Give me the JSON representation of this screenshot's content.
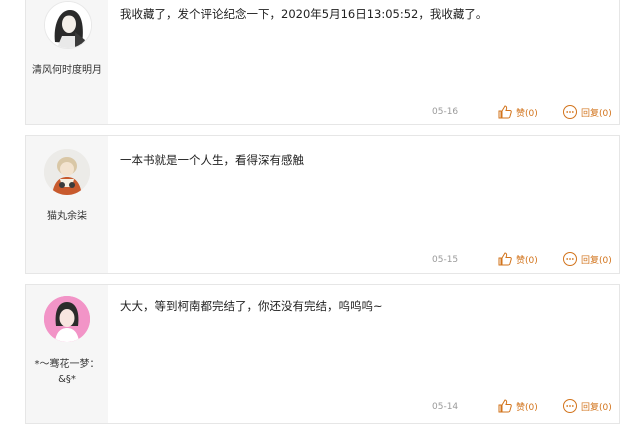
{
  "comments": [
    {
      "username": "清风何时度明月",
      "content": "我收藏了，发个评论纪念一下，2020年5月16日13:05:52，我收藏了。",
      "date": "05-16",
      "like_label": "赞(0)",
      "reply_label": "回复(0)"
    },
    {
      "username": "猫丸余柒",
      "content": "一本书就是一个人生，看得深有感触",
      "date": "05-15",
      "like_label": "赞(0)",
      "reply_label": "回复(0)"
    },
    {
      "username_line1": "*～骞花一梦：",
      "username_line2": "&§*",
      "content": "大大，等到柯南都完结了，你还没有完结，呜呜呜~",
      "date": "05-14",
      "like_label": "赞(0)",
      "reply_label": "回复(0)"
    }
  ],
  "colors": {
    "accent": "#d2731b",
    "date": "#9a9a9a",
    "sidebar": "#f6f6f6"
  },
  "icons": {
    "like": "thumbs-up-icon",
    "reply": "speech-bubble-icon"
  }
}
